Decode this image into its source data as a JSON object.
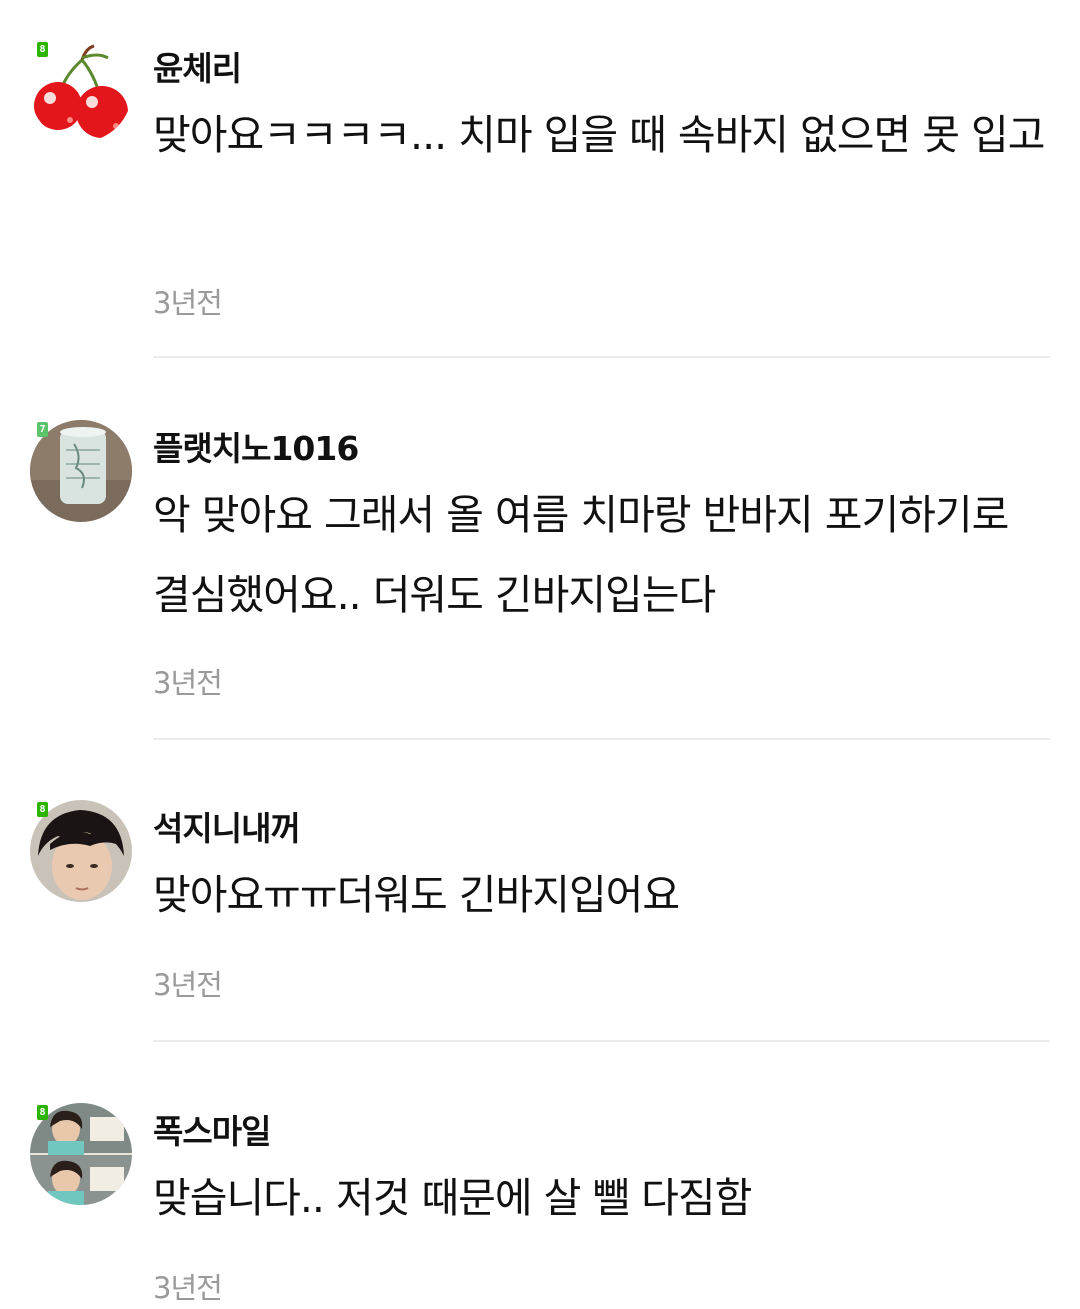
{
  "comments": [
    {
      "username": "윤체리",
      "text": "맞아요ㅋㅋㅋㅋ... 치마 입을 때 속바지 없으면 못 입고",
      "time": "3년전",
      "level_badge": "8",
      "badge_color": "#2db400",
      "avatar_icon": "cherry-avatar"
    },
    {
      "username": "플랫치노1016",
      "text": "악 맞아요 그래서 올 여름 치마랑 반바지 포기하기로 결심했어요.. 더워도 긴바지입는다",
      "time": "3년전",
      "level_badge": "7",
      "badge_color": "#5cc46b",
      "avatar_icon": "cup-avatar"
    },
    {
      "username": "석지니내꺼",
      "text": "맞아요ㅠㅠ더워도 긴바지입어요",
      "time": "3년전",
      "level_badge": "8",
      "badge_color": "#2db400",
      "avatar_icon": "person-avatar"
    },
    {
      "username": "폭스마일",
      "text": "맞습니다.. 저것 때문에 살 뺄 다짐함",
      "time": "3년전",
      "level_badge": "8",
      "badge_color": "#2db400",
      "avatar_icon": "photo-avatar"
    }
  ]
}
